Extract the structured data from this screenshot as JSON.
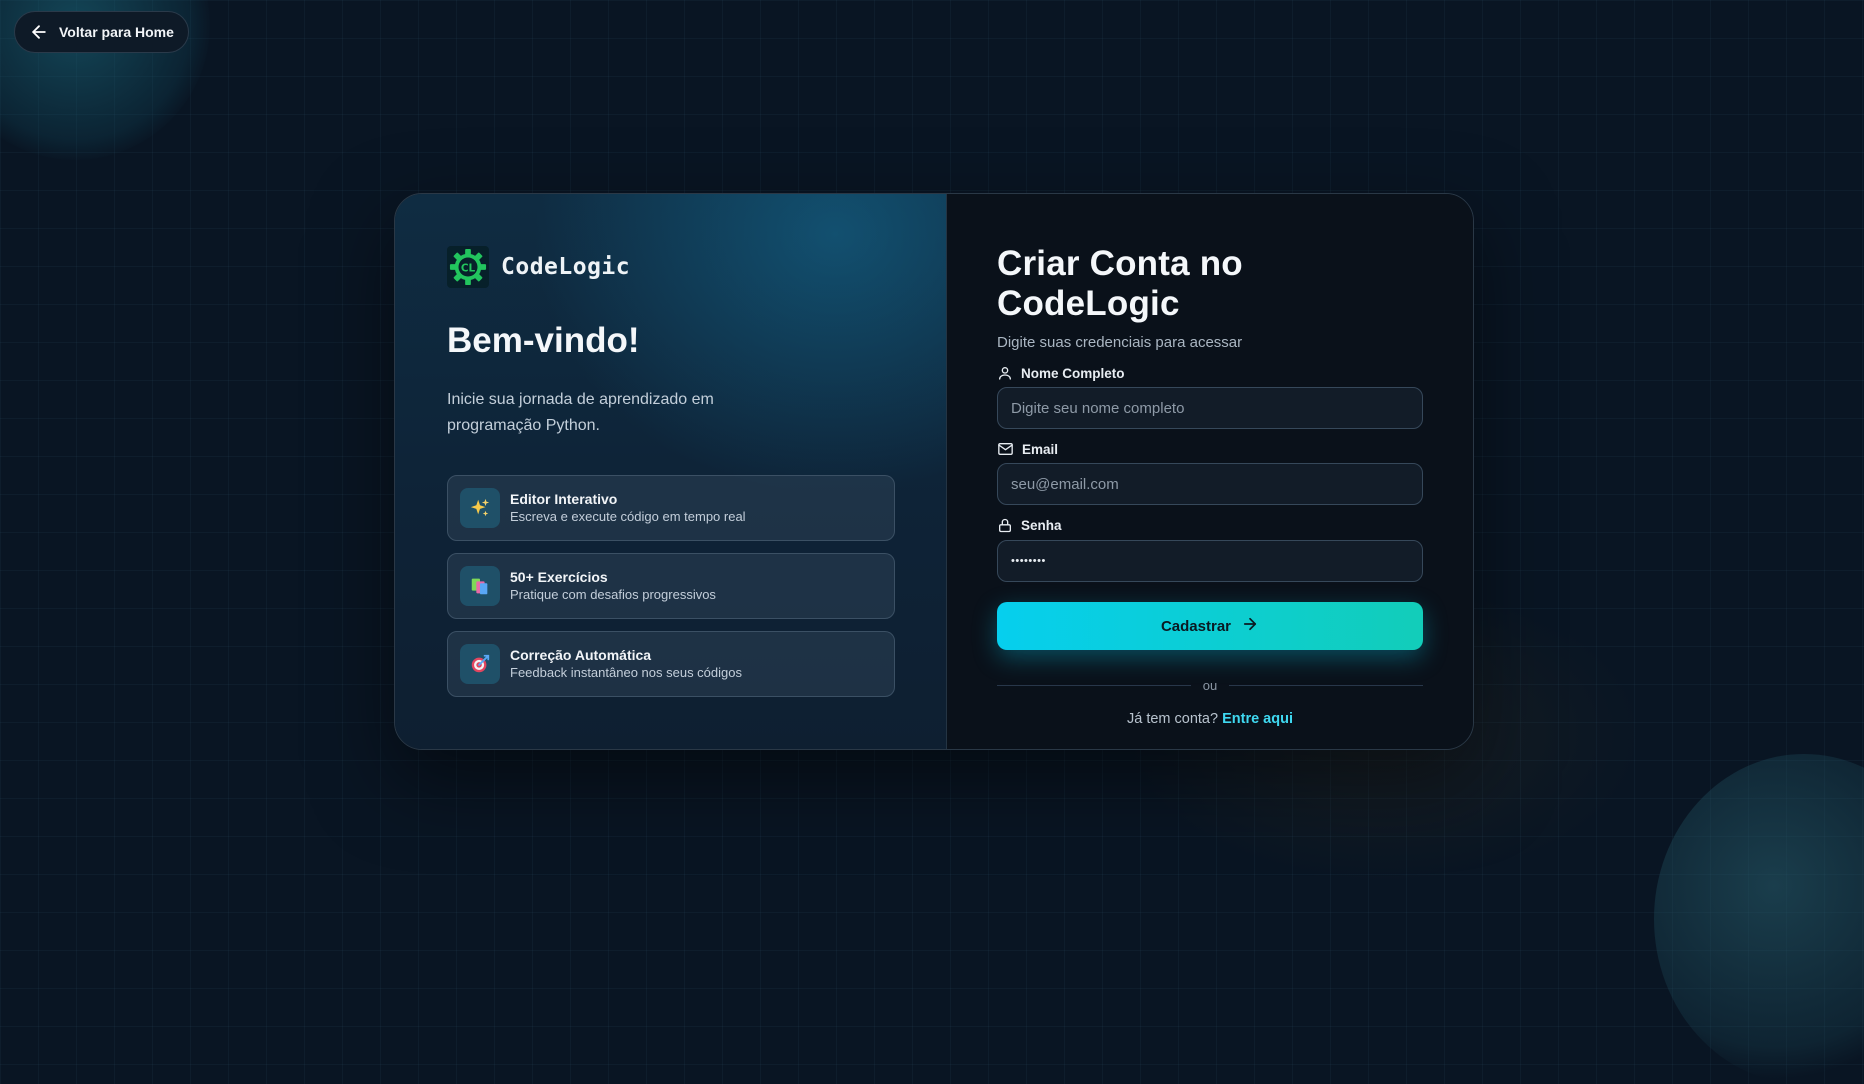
{
  "nav": {
    "back_label": "Voltar para Home"
  },
  "brand": {
    "name": "CodeLogic",
    "logo_text": "CL"
  },
  "welcome": {
    "title": "Bem-vindo!",
    "text": "Inicie sua jornada de aprendizado em programação Python."
  },
  "features": [
    {
      "icon": "sparkles-icon",
      "title": "Editor Interativo",
      "description": "Escreva e execute código em tempo real"
    },
    {
      "icon": "books-icon",
      "title": "50+ Exercícios",
      "description": "Pratique com desafios progressivos"
    },
    {
      "icon": "target-icon",
      "title": "Correção Automática",
      "description": "Feedback instantâneo nos seus códigos"
    }
  ],
  "form": {
    "title": "Criar Conta no CodeLogic",
    "subtitle": "Digite suas credenciais para acessar",
    "name_label": "Nome Completo",
    "name_placeholder": "Digite seu nome completo",
    "email_label": "Email",
    "email_placeholder": "seu@email.com",
    "password_label": "Senha",
    "password_value": "••••••••",
    "submit_label": "Cadastrar",
    "divider_text": "ou",
    "signin_prompt": "Já tem conta?",
    "signin_link": "Entre aqui"
  },
  "colors": {
    "background": "#091523",
    "accent": "#06cfee",
    "accent_end": "#12cdb9",
    "link": "#3fd8f0",
    "logo_green": "#22c55e"
  }
}
